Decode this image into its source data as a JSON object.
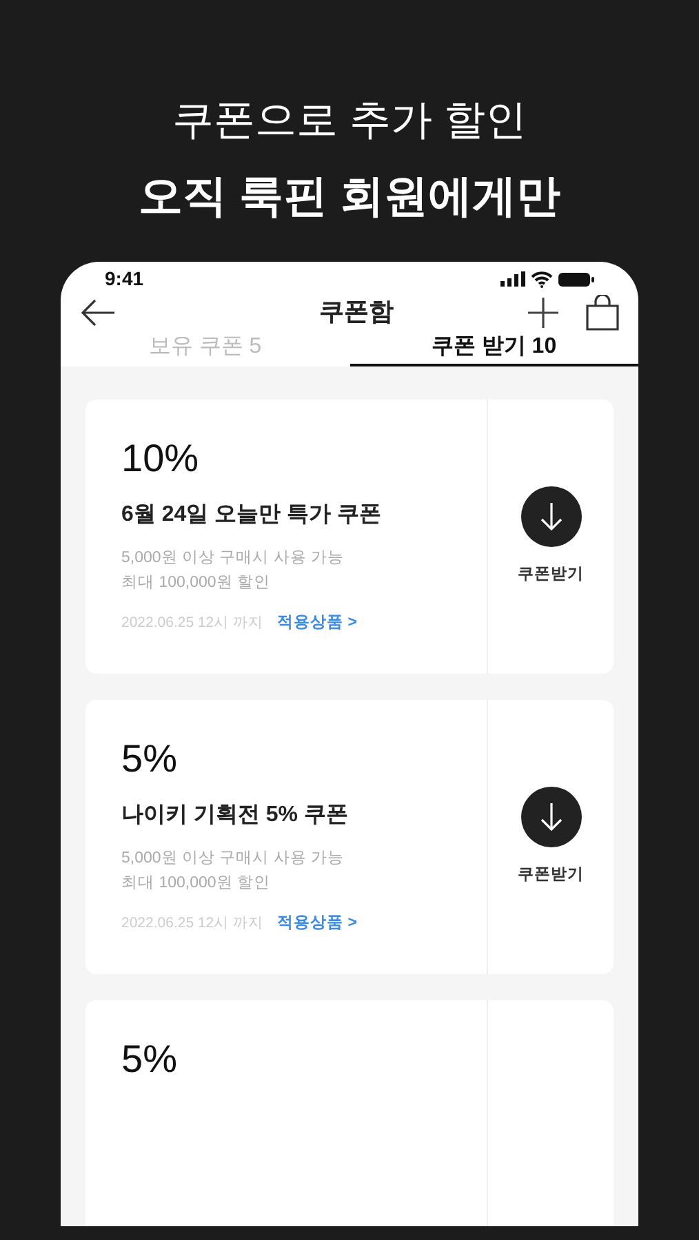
{
  "promo": {
    "subtitle": "쿠폰으로 추가 할인",
    "headline": "오직 룩핀 회원에게만"
  },
  "status_bar": {
    "time": "9:41"
  },
  "header": {
    "title": "쿠폰함"
  },
  "tabs": [
    {
      "label": "보유 쿠폰 5",
      "selected": false
    },
    {
      "label": "쿠폰 받기 10",
      "selected": true
    }
  ],
  "coupons": [
    {
      "discount": "10%",
      "title": "6월 24일 오늘만 특가 쿠폰",
      "conditions": [
        "5,000원 이상 구매시 사용 가능",
        "최대 100,000원 할인"
      ],
      "expiry": "2022.06.25 12시 까지",
      "link": "적용상품 >",
      "action": "쿠폰받기"
    },
    {
      "discount": "5%",
      "title": "나이키 기획전 5% 쿠폰",
      "conditions": [
        "5,000원 이상 구매시 사용 가능",
        "최대 100,000원 할인"
      ],
      "expiry": "2022.06.25 12시 까지",
      "link": "적용상품 >",
      "action": "쿠폰받기"
    },
    {
      "discount": "5%"
    }
  ]
}
